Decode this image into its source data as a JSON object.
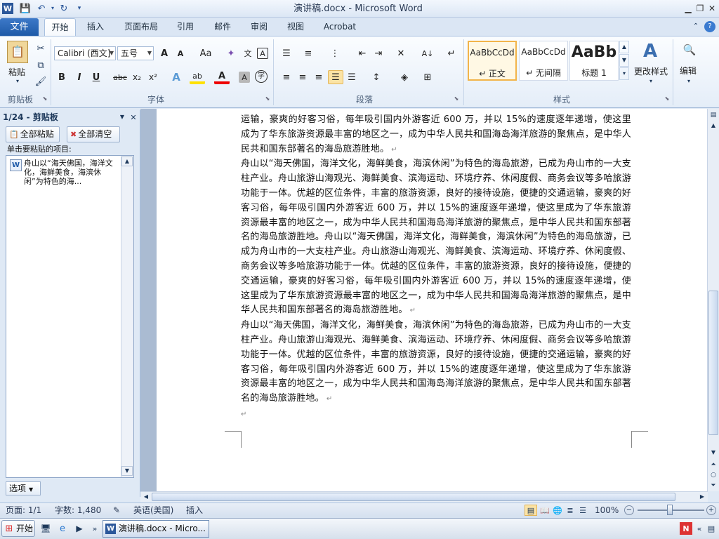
{
  "titlebar": {
    "title": "演讲稿.docx - Microsoft Word",
    "app_icon": "W"
  },
  "tabs": {
    "file": "文件",
    "items": [
      "开始",
      "插入",
      "页面布局",
      "引用",
      "邮件",
      "审阅",
      "视图",
      "Acrobat"
    ]
  },
  "ribbon": {
    "clipboard": {
      "label": "剪贴板",
      "paste": "粘贴"
    },
    "font": {
      "label": "字体",
      "font_name": "Calibri (西文]",
      "font_size": "五号",
      "grow": "A",
      "shrink": "A",
      "case": "Aa",
      "bold": "B",
      "italic": "I",
      "underline": "U",
      "strike": "abc",
      "sub": "x₂",
      "sup": "x²",
      "text_effect": "A",
      "highlight": "ab",
      "font_color": "A",
      "char_shade": "A",
      "enclose": "字"
    },
    "paragraph": {
      "label": "段落"
    },
    "styles": {
      "label": "样式",
      "items": [
        {
          "sample": "AaBbCcDd",
          "name": "↵ 正文"
        },
        {
          "sample": "AaBbCcDd",
          "name": "↵ 无间隔"
        },
        {
          "sample": "AaBb",
          "name": "标题 1"
        }
      ],
      "change_styles": "更改样式"
    },
    "editing": {
      "label": "编辑"
    }
  },
  "clipboard_pane": {
    "title": "1/24 - 剪贴板",
    "paste_all": "全部粘贴",
    "clear_all": "全部清空",
    "instruction": "单击要粘贴的项目:",
    "item_text": "舟山以“海天佛国，海洋文化，海鲜美食，海滨休闲”为特色的海...",
    "options": "选项"
  },
  "document": {
    "paragraphs": [
      "运输，豪爽的好客习俗，每年吸引国内外游客近 600 万，并以 15%的速度逐年递增，使这里成为了华东旅游资源最丰富的地区之一，成为中华人民共和国海岛海洋旅游的聚焦点，是中华人民共和国东部著名的海岛旅游胜地。",
      "舟山以“海天佛国，海洋文化，海鲜美食，海滨休闲”为特色的海岛旅游，已成为舟山市的一大支柱产业。舟山旅游山海观光、海鲜美食、滨海运动、环境疗养、休闲度假、商务会议等多哈旅游功能于一体。优越的区位条件，丰富的旅游资源，良好的接待设施，便捷的交通运输，豪爽的好客习俗，每年吸引国内外游客近 600 万，并以 15%的速度逐年递增，使这里成为了华东旅游资源最丰富的地区之一，成为中华人民共和国海岛海洋旅游的聚焦点，是中华人民共和国东部著名的海岛旅游胜地。舟山以“海天佛国，海洋文化，海鲜美食，海滨休闲”为特色的海岛旅游，已成为舟山市的一大支柱产业。舟山旅游山海观光、海鲜美食、滨海运动、环境疗养、休闲度假、商务会议等多哈旅游功能于一体。优越的区位条件，丰富的旅游资源，良好的接待设施，便捷的交通运输，豪爽的好客习俗，每年吸引国内外游客近 600 万，并以 15%的速度逐年递增，使这里成为了华东旅游资源最丰富的地区之一，成为中华人民共和国海岛海洋旅游的聚焦点，是中华人民共和国东部著名的海岛旅游胜地。",
      "舟山以“海天佛国，海洋文化，海鲜美食，海滨休闲”为特色的海岛旅游，已成为舟山市的一大支柱产业。舟山旅游山海观光、海鲜美食、滨海运动、环境疗养、休闲度假、商务会议等多哈旅游功能于一体。优越的区位条件，丰富的旅游资源，良好的接待设施，便捷的交通运输，豪爽的好客习俗，每年吸引国内外游客近 600 万，并以 15%的速度逐年递增，使这里成为了华东旅游资源最丰富的地区之一，成为中华人民共和国海岛海洋旅游的聚焦点，是中华人民共和国东部著名的海岛旅游胜地。"
    ],
    "empty_mark": "↵"
  },
  "statusbar": {
    "page": "页面: 1/1",
    "words": "字数: 1,480",
    "language": "英语(美国)",
    "mode": "插入",
    "zoom": "100%"
  },
  "taskbar": {
    "start": "开始",
    "window": "演讲稿.docx - Micro..."
  }
}
